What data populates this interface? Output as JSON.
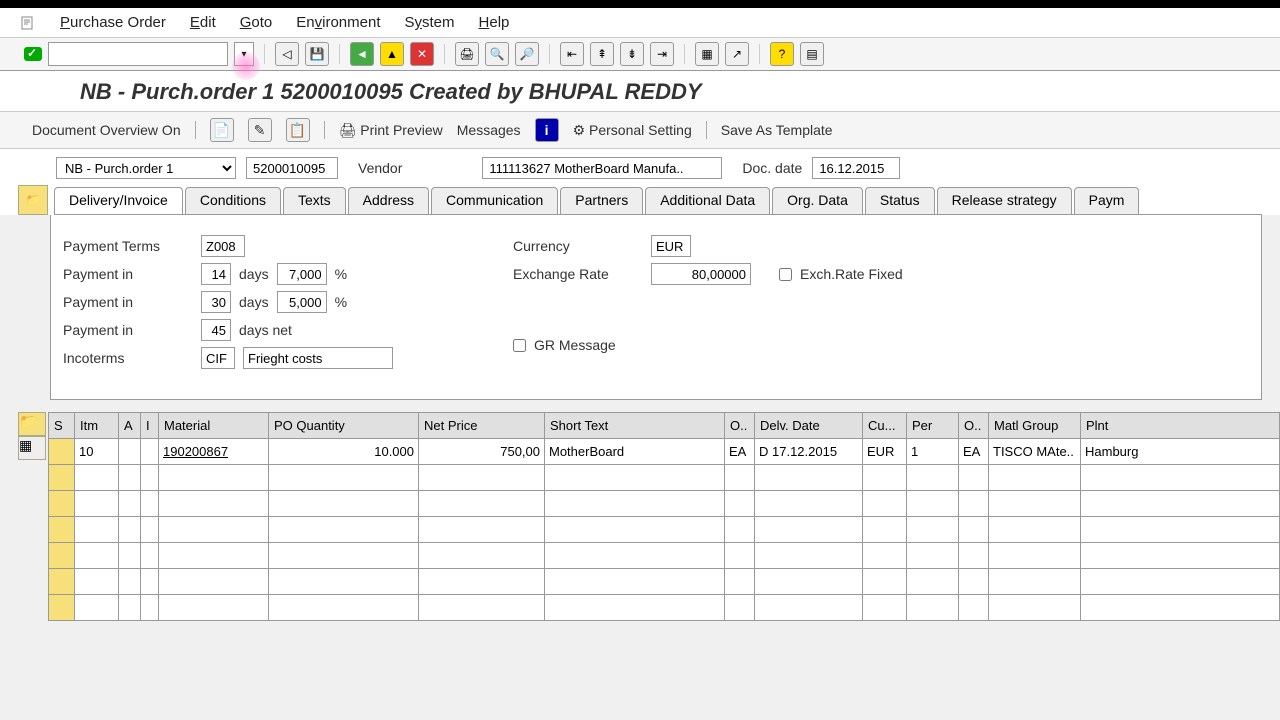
{
  "menu": {
    "items": [
      "Purchase Order",
      "Edit",
      "Goto",
      "Environment",
      "System",
      "Help"
    ],
    "underlines": [
      "P",
      "E",
      "G",
      "E",
      "S",
      "H"
    ]
  },
  "title": "NB - Purch.order 1 5200010095 Created by BHUPAL REDDY",
  "action_bar": {
    "doc_overview": "Document Overview On",
    "print_preview": "Print Preview",
    "messages": "Messages",
    "personal_setting": "Personal Setting",
    "save_template": "Save As Template"
  },
  "header": {
    "doc_type": "NB - Purch.order 1",
    "doc_number": "5200010095",
    "vendor_label": "Vendor",
    "vendor_value": "111113627 MotherBoard Manufa..",
    "doc_date_label": "Doc. date",
    "doc_date": "16.12.2015"
  },
  "tabs": [
    "Delivery/Invoice",
    "Conditions",
    "Texts",
    "Address",
    "Communication",
    "Partners",
    "Additional Data",
    "Org. Data",
    "Status",
    "Release strategy",
    "Paym"
  ],
  "active_tab": 0,
  "delivery_invoice": {
    "payment_terms_lbl": "Payment Terms",
    "payment_terms": "Z008",
    "payment_in_lbl": "Payment in",
    "p1_days": "14",
    "p1_disc": "7,000",
    "p2_days": "30",
    "p2_disc": "5,000",
    "p3_days": "45",
    "days_txt": "days",
    "days_net_txt": "days net",
    "pct": "%",
    "incoterms_lbl": "Incoterms",
    "incoterms": "CIF",
    "incoterms_txt": "Frieght costs",
    "currency_lbl": "Currency",
    "currency": "EUR",
    "exch_rate_lbl": "Exchange Rate",
    "exch_rate": "80,00000",
    "exch_fixed_lbl": "Exch.Rate Fixed",
    "gr_msg_lbl": "GR Message"
  },
  "grid": {
    "headers": [
      "S",
      "Itm",
      "A",
      "I",
      "Material",
      "PO Quantity",
      "Net Price",
      "Short Text",
      "O..",
      "Delv. Date",
      "Cu...",
      "Per",
      "O..",
      "Matl Group",
      "Plnt"
    ],
    "row1": {
      "itm": "10",
      "material": "190200867",
      "qty": "10.000",
      "price": "750,00",
      "short_text": "MotherBoard",
      "oun1": "EA",
      "delv_date": "D  17.12.2015",
      "curr": "EUR",
      "per": "1",
      "oun2": "EA",
      "matl_group": "TISCO MAte..",
      "plnt": "Hamburg"
    }
  }
}
